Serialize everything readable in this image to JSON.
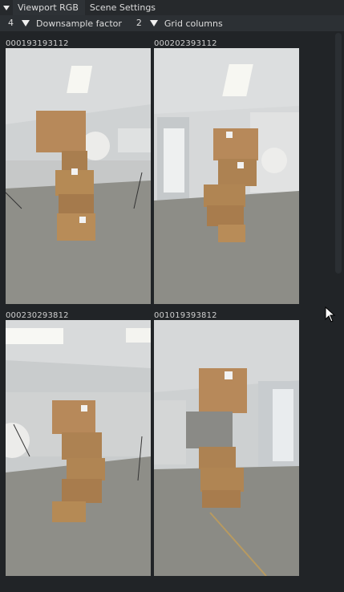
{
  "tabs": [
    {
      "label": "Viewport RGB"
    },
    {
      "label": "Scene Settings"
    }
  ],
  "controls": {
    "downsample_value": "4",
    "downsample_label": "Downsample factor",
    "grid_value": "2",
    "grid_label": "Grid columns"
  },
  "images": [
    {
      "id": "000193193112"
    },
    {
      "id": "000202393112"
    },
    {
      "id": "000230293812"
    },
    {
      "id": "001019393812"
    }
  ],
  "colors": {
    "panel_bg": "#212427",
    "tab_bg": "#26292c",
    "control_bg": "#2c3034",
    "box": "#b58a55",
    "floor": "#8e8e88"
  }
}
